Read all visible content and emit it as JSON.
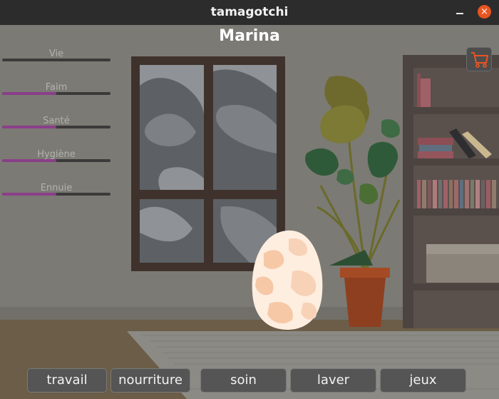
{
  "window": {
    "title": "tamagotchi",
    "close_glyph": "×"
  },
  "pet": {
    "name": "Marina"
  },
  "stats": [
    {
      "label": "Vie",
      "level": 0.0
    },
    {
      "label": "Faim",
      "level": 0.5
    },
    {
      "label": "Santé",
      "level": 0.5
    },
    {
      "label": "Hygiène",
      "level": 0.5
    },
    {
      "label": "Ennuie",
      "level": 0.5
    }
  ],
  "shop": {
    "icon": "shopping-cart-icon",
    "color": "#e95420"
  },
  "actions": [
    {
      "label": "travail"
    },
    {
      "label": "nourriture"
    },
    {
      "label": "soin"
    },
    {
      "label": "laver"
    },
    {
      "label": "jeux"
    }
  ],
  "colors": {
    "stat_fill": "#8a3f8a",
    "accent": "#e95420"
  }
}
